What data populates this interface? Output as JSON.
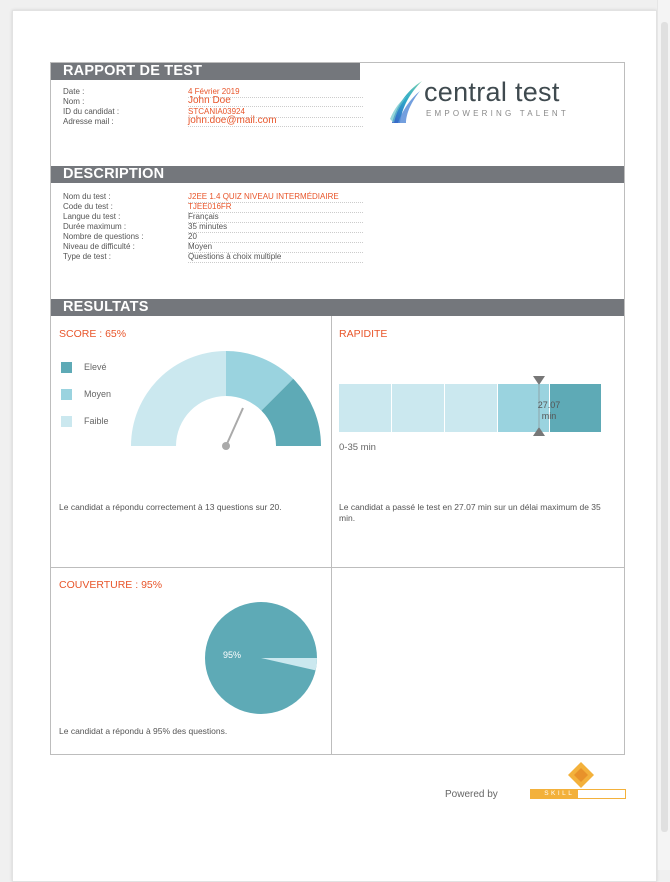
{
  "colors": {
    "orange": "#e8552a",
    "header_gray": "#74777c",
    "teal_dark": "#5eaab6",
    "teal_mid": "#9ad3df",
    "teal_light": "#cbe8ef"
  },
  "report": {
    "title": "RAPPORT DE TEST",
    "fields": [
      {
        "label": "Date :",
        "value": "4 Février 2019"
      },
      {
        "label": "Nom :",
        "value": "John Doe"
      },
      {
        "label": "ID du candidat :",
        "value": "STCANIA03924"
      },
      {
        "label": "Adresse mail :",
        "value": "john.doe@mail.com"
      }
    ]
  },
  "logo": {
    "name": "central test",
    "tagline": "EMPOWERING TALENT",
    "icon": "swoosh-logo"
  },
  "description": {
    "title": "DESCRIPTION",
    "fields": [
      {
        "label": "Nom du test :",
        "value": "J2EE 1.4 QUIZ NIVEAU INTERMÉDIAIRE"
      },
      {
        "label": "Code du test :",
        "value": "TJEE016FR"
      },
      {
        "label": "Langue du test :",
        "value": "Français"
      },
      {
        "label": "Durée maximum :",
        "value": "35 minutes"
      },
      {
        "label": "Nombre de questions :",
        "value": "20"
      },
      {
        "label": "Niveau de difficulté :",
        "value": "Moyen"
      },
      {
        "label": "Type de test :",
        "value": "Questions à choix multiple"
      }
    ]
  },
  "results": {
    "title": "RESULTATS",
    "score": {
      "title": "SCORE : 65%",
      "legend": [
        "Elevé",
        "Moyen",
        "Faible"
      ],
      "note": "Le candidat a répondu correctement à 13 questions sur 20."
    },
    "speed": {
      "title": "RAPIDITE",
      "marker_value": "27.07",
      "marker_unit": "min",
      "range_label": "0-35 min",
      "note": "Le candidat a passé le test en 27.07 min sur un délai maximum de 35 min."
    },
    "coverage": {
      "title": "COUVERTURE : 95%",
      "pie_label": "95%",
      "note": "Le candidat a répondu à 95% des questions."
    }
  },
  "chart_data": [
    {
      "type": "gauge",
      "title": "SCORE : 65%",
      "value": 65,
      "range": [
        0,
        100
      ],
      "bands": [
        {
          "name": "Faible",
          "from": 0,
          "to": 50
        },
        {
          "name": "Moyen",
          "from": 50,
          "to": 80
        },
        {
          "name": "Elevé",
          "from": 80,
          "to": 100
        }
      ]
    },
    {
      "type": "bar",
      "title": "RAPIDITE",
      "value": 27.07,
      "range": [
        0,
        35
      ],
      "unit": "min",
      "segments": [
        7,
        14,
        21,
        28,
        35
      ]
    },
    {
      "type": "pie",
      "title": "COUVERTURE : 95%",
      "slices": [
        {
          "label": "95%",
          "value": 95
        },
        {
          "value": 5
        }
      ]
    }
  ],
  "footer": {
    "powered_by": "Powered by",
    "brand": "SKILL VALUE"
  }
}
